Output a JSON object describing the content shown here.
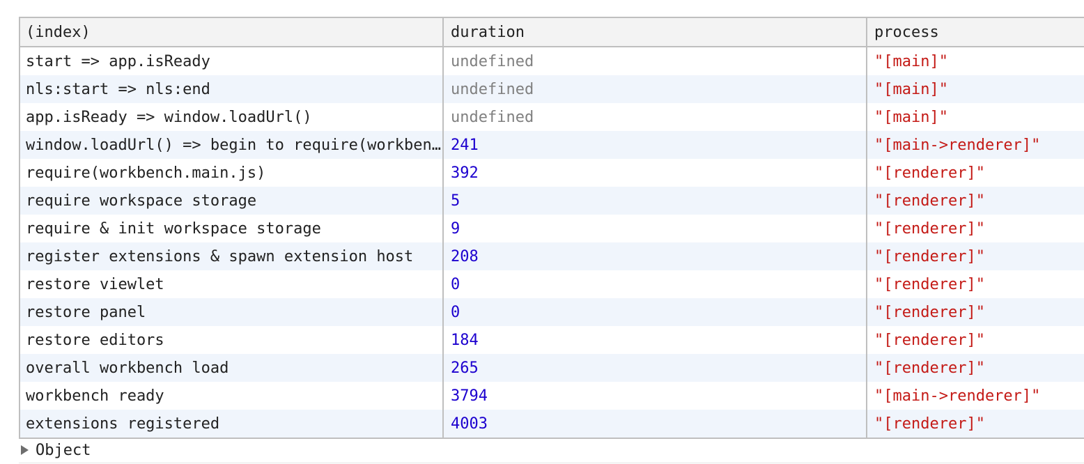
{
  "table": {
    "headers": {
      "index": "(index)",
      "duration": "duration",
      "process": "process"
    },
    "rows": [
      {
        "index": "start => app.isReady",
        "duration": "undefined",
        "duration_type": "undefined",
        "process": "\"[main]\""
      },
      {
        "index": "nls:start => nls:end",
        "duration": "undefined",
        "duration_type": "undefined",
        "process": "\"[main]\""
      },
      {
        "index": "app.isReady => window.loadUrl()",
        "duration": "undefined",
        "duration_type": "undefined",
        "process": "\"[main]\""
      },
      {
        "index": "window.loadUrl() => begin to require(workbench.main.js)",
        "duration": "241",
        "duration_type": "number",
        "process": "\"[main->renderer]\""
      },
      {
        "index": "require(workbench.main.js)",
        "duration": "392",
        "duration_type": "number",
        "process": "\"[renderer]\""
      },
      {
        "index": "require workspace storage",
        "duration": "5",
        "duration_type": "number",
        "process": "\"[renderer]\""
      },
      {
        "index": "require & init workspace storage",
        "duration": "9",
        "duration_type": "number",
        "process": "\"[renderer]\""
      },
      {
        "index": "register extensions & spawn extension host",
        "duration": "208",
        "duration_type": "number",
        "process": "\"[renderer]\""
      },
      {
        "index": "restore viewlet",
        "duration": "0",
        "duration_type": "number",
        "process": "\"[renderer]\""
      },
      {
        "index": "restore panel",
        "duration": "0",
        "duration_type": "number",
        "process": "\"[renderer]\""
      },
      {
        "index": "restore editors",
        "duration": "184",
        "duration_type": "number",
        "process": "\"[renderer]\""
      },
      {
        "index": "overall workbench load",
        "duration": "265",
        "duration_type": "number",
        "process": "\"[renderer]\""
      },
      {
        "index": "workbench ready",
        "duration": "3794",
        "duration_type": "number",
        "process": "\"[main->renderer]\""
      },
      {
        "index": "extensions registered",
        "duration": "4003",
        "duration_type": "number",
        "process": "\"[renderer]\""
      }
    ]
  },
  "footer": {
    "object_label": "Object",
    "expand_icon": "triangle-right-icon"
  },
  "colors": {
    "undefined": "#808080",
    "number": "#1c00cf",
    "string": "#c41a16",
    "header_bg": "#f3f3f3",
    "alt_row_bg": "#f0f5fc",
    "border": "#bfbfbf"
  }
}
